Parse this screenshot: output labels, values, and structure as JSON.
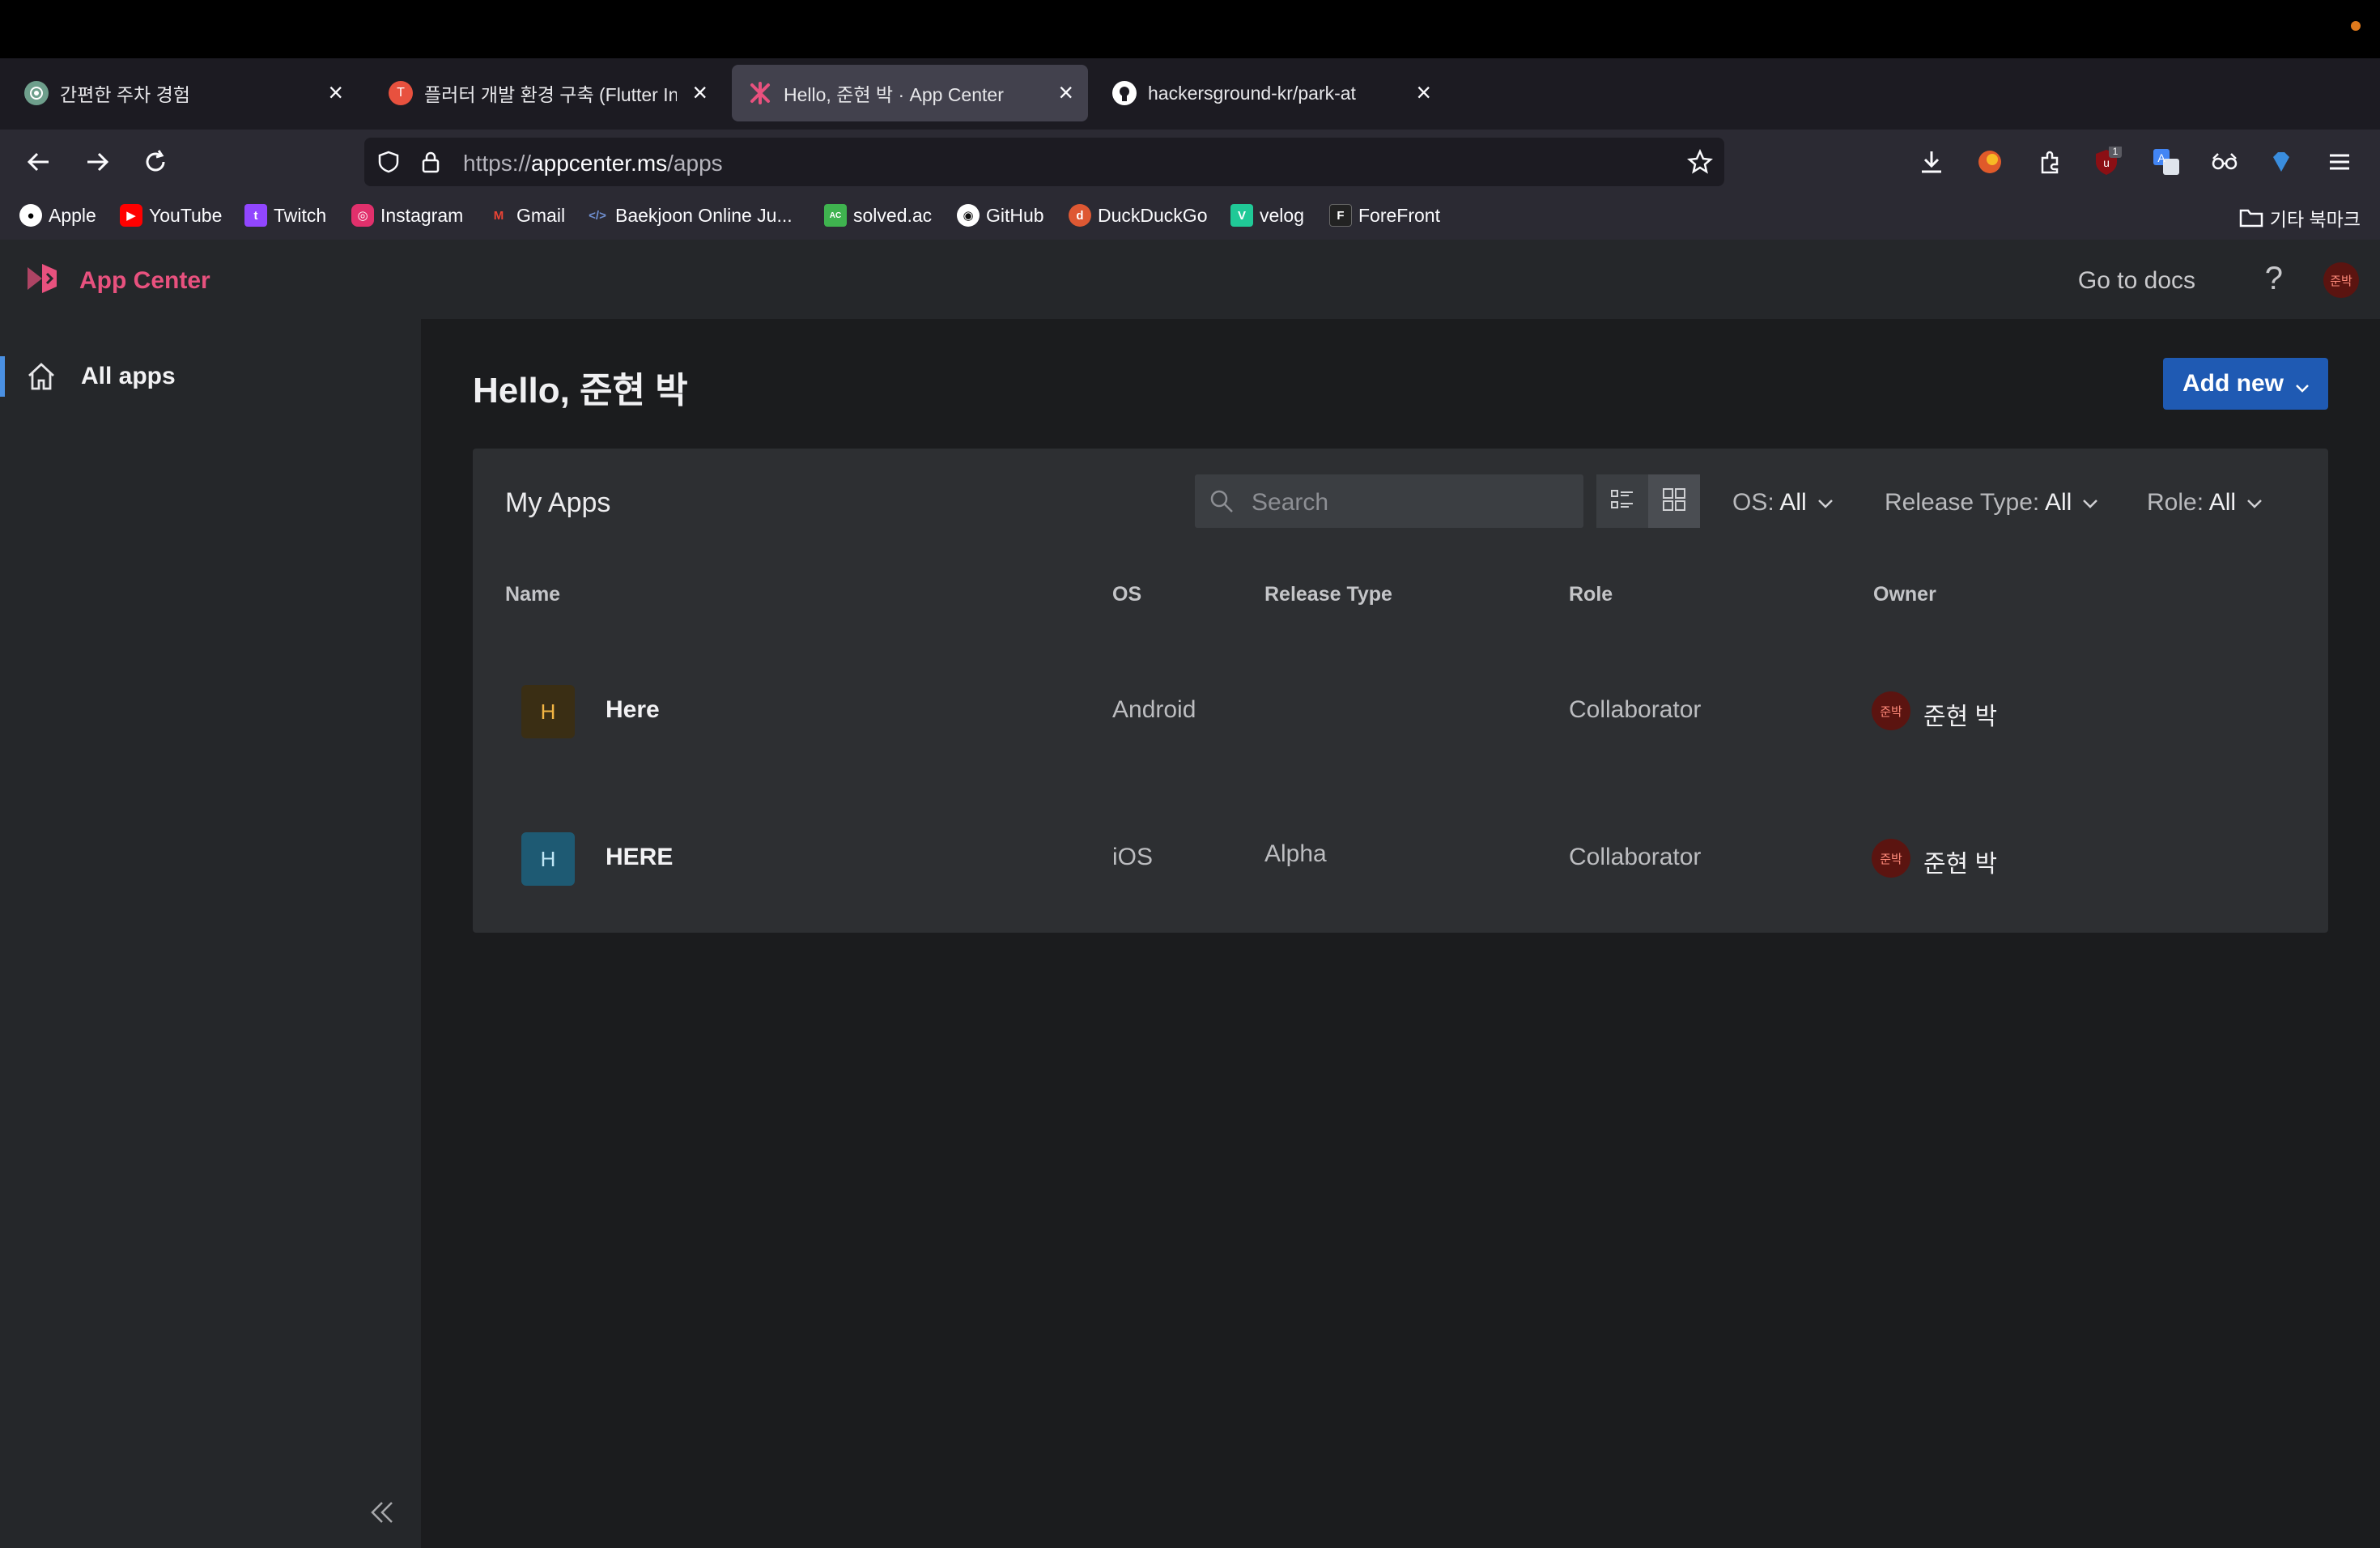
{
  "browser": {
    "tabs": [
      {
        "title": "간편한 주차 경험",
        "favicon": "openai-icon",
        "active": false
      },
      {
        "title": "플러터 개발 환경 구축 (Flutter Insta",
        "favicon": "t-icon",
        "active": false
      },
      {
        "title": "Hello, 준현 박 · App Center",
        "favicon": "appcenter-icon",
        "active": true
      },
      {
        "title": "hackersground-kr/park-at",
        "favicon": "github-icon",
        "active": false
      }
    ],
    "url_scheme": "https://",
    "url_domain": "appcenter.ms",
    "url_path": "/apps",
    "extension_badge": "1",
    "bookmarks": [
      {
        "label": "Apple",
        "color": "#ffffff"
      },
      {
        "label": "YouTube",
        "color": "#ff0000"
      },
      {
        "label": "Twitch",
        "color": "#9146ff"
      },
      {
        "label": "Instagram",
        "color": "#e1306c"
      },
      {
        "label": "Gmail",
        "color": "#ea4335"
      },
      {
        "label": "Baekjoon Online Ju...",
        "color": "#4a6fa5"
      },
      {
        "label": "solved.ac",
        "color": "#3fb34f"
      },
      {
        "label": "GitHub",
        "color": "#ffffff"
      },
      {
        "label": "DuckDuckGo",
        "color": "#de5833"
      },
      {
        "label": "velog",
        "color": "#20c997"
      },
      {
        "label": "ForeFront",
        "color": "#222222"
      }
    ],
    "other_bookmarks": "기타 북마크"
  },
  "header": {
    "app_title": "App Center",
    "docs_label": "Go to docs",
    "help_label": "?",
    "user_initials": "준박"
  },
  "sidebar": {
    "items": [
      {
        "label": "All apps",
        "icon": "home-icon"
      }
    ]
  },
  "main": {
    "greeting": "Hello, 준현 박",
    "add_new_label": "Add new",
    "card_title": "My Apps",
    "search_placeholder": "Search",
    "filters": {
      "os_label": "OS:",
      "os_value": "All",
      "release_label": "Release Type:",
      "release_value": "All",
      "role_label": "Role:",
      "role_value": "All"
    },
    "columns": [
      "Name",
      "OS",
      "Release Type",
      "Role",
      "Owner"
    ],
    "apps": [
      {
        "initial": "H",
        "name": "Here",
        "os": "Android",
        "release_type": "",
        "role": "Collaborator",
        "owner": "준현 박",
        "owner_initials": "준박",
        "icon_bg": "#3a2e14",
        "icon_fg": "#f2b544"
      },
      {
        "initial": "H",
        "name": "HERE",
        "os": "iOS",
        "release_type": "Alpha",
        "role": "Collaborator",
        "owner": "준현 박",
        "owner_initials": "준박",
        "icon_bg": "#1e5a73",
        "icon_fg": "#bfe6f5"
      }
    ]
  }
}
